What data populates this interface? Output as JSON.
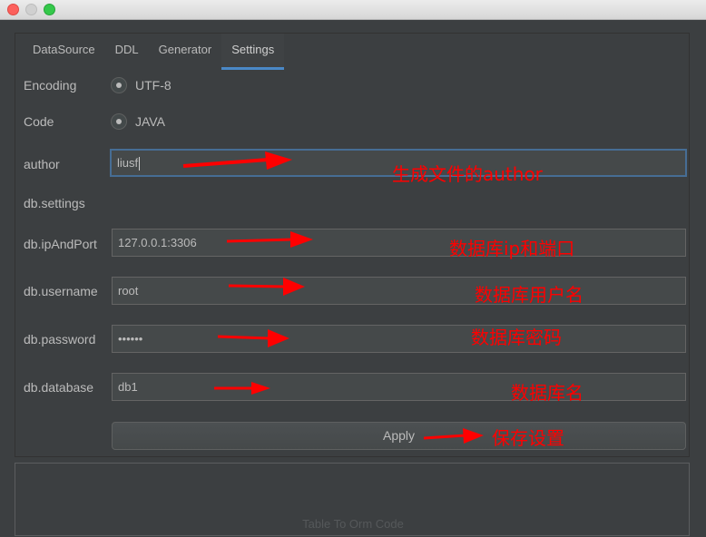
{
  "tabs": [
    {
      "label": "DataSource"
    },
    {
      "label": "DDL"
    },
    {
      "label": "Generator"
    },
    {
      "label": "Settings",
      "active": true
    }
  ],
  "settings": {
    "encoding_label": "Encoding",
    "encoding_value": "UTF-8",
    "code_label": "Code",
    "code_value": "JAVA",
    "author_label": "author",
    "author_value": "liusf",
    "db_settings_label": "db.settings",
    "ip_label": "db.ipAndPort",
    "ip_value": "127.0.0.1:3306",
    "username_label": "db.username",
    "username_value": "root",
    "password_label": "db.password",
    "password_value": "••••••",
    "database_label": "db.database",
    "database_value": "db1",
    "apply_label": "Apply"
  },
  "annotations": {
    "author": "生成文件的author",
    "ip": "数据库ip和端口",
    "username": "数据库用户名",
    "password": "数据库密码",
    "database": "数据库名",
    "apply": "保存设置"
  },
  "status_text": "Table To Orm Code",
  "colors": {
    "annotation": "#ff0000",
    "active_tab": "#4a88c7",
    "focus_border": "#466d94"
  }
}
